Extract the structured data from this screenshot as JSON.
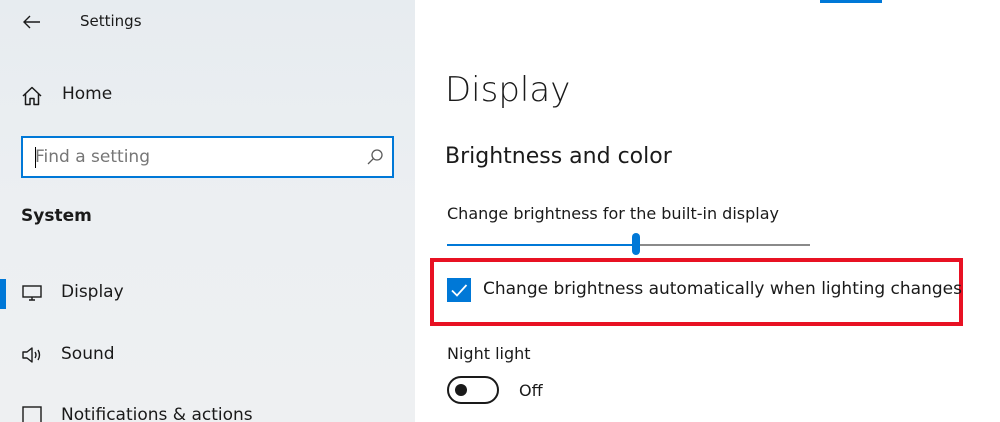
{
  "window": {
    "title": "Settings",
    "back_icon": "back-arrow-icon"
  },
  "sidebar": {
    "home": {
      "label": "Home",
      "icon": "home-icon"
    },
    "search": {
      "placeholder": "Find a setting",
      "value": "",
      "icon": "search-icon"
    },
    "section_title": "System",
    "items": [
      {
        "label": "Display",
        "icon": "monitor-icon",
        "selected": true
      },
      {
        "label": "Sound",
        "icon": "speaker-icon",
        "selected": false
      },
      {
        "label": "Notifications & actions",
        "icon": "notifications-icon",
        "selected": false
      }
    ]
  },
  "main": {
    "page_title": "Display",
    "section_title": "Brightness and color",
    "brightness": {
      "label": "Change brightness for the built-in display",
      "value_fraction": 0.52
    },
    "auto_brightness": {
      "label": "Change brightness automatically when lighting changes",
      "checked": true
    },
    "night_light": {
      "label": "Night light",
      "state_label": "Off",
      "on": false
    }
  },
  "colors": {
    "accent": "#0078d7",
    "highlight": "#e81123",
    "sidebar_bg": "#e8edf1"
  }
}
